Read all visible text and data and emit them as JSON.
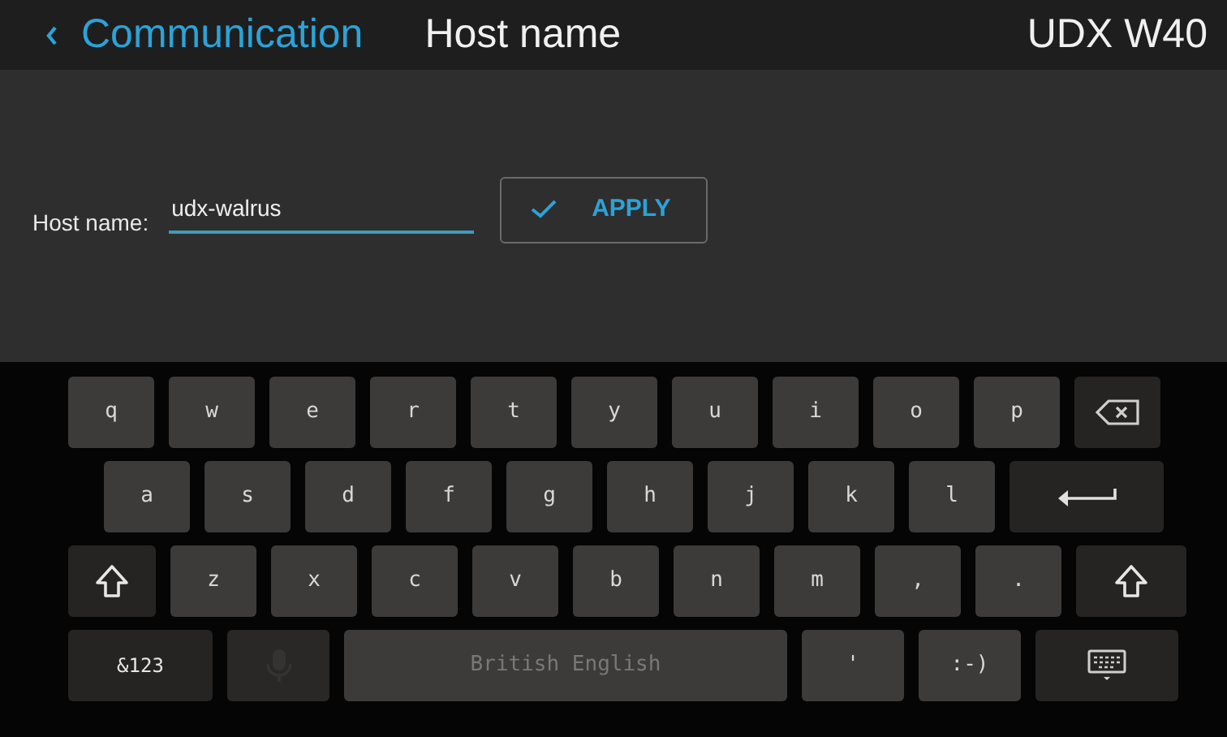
{
  "header": {
    "back_label": "Communication",
    "title": "Host name",
    "device": "UDX W40"
  },
  "form": {
    "label": "Host name:",
    "value": "udx-walrus",
    "apply": "APPLY"
  },
  "keyboard": {
    "rows": [
      {
        "keys": [
          {
            "kind": "letter",
            "label": "q"
          },
          {
            "kind": "letter",
            "label": "w"
          },
          {
            "kind": "letter",
            "label": "e"
          },
          {
            "kind": "letter",
            "label": "r"
          },
          {
            "kind": "letter",
            "label": "t"
          },
          {
            "kind": "letter",
            "label": "y"
          },
          {
            "kind": "letter",
            "label": "u"
          },
          {
            "kind": "letter",
            "label": "i"
          },
          {
            "kind": "letter",
            "label": "o"
          },
          {
            "kind": "letter",
            "label": "p"
          },
          {
            "kind": "backspace"
          }
        ]
      },
      {
        "keys": [
          {
            "kind": "letter",
            "label": "a"
          },
          {
            "kind": "letter",
            "label": "s"
          },
          {
            "kind": "letter",
            "label": "d"
          },
          {
            "kind": "letter",
            "label": "f"
          },
          {
            "kind": "letter",
            "label": "g"
          },
          {
            "kind": "letter",
            "label": "h"
          },
          {
            "kind": "letter",
            "label": "j"
          },
          {
            "kind": "letter",
            "label": "k"
          },
          {
            "kind": "letter",
            "label": "l"
          },
          {
            "kind": "enter"
          }
        ]
      },
      {
        "keys": [
          {
            "kind": "shift"
          },
          {
            "kind": "letter",
            "label": "z"
          },
          {
            "kind": "letter",
            "label": "x"
          },
          {
            "kind": "letter",
            "label": "c"
          },
          {
            "kind": "letter",
            "label": "v"
          },
          {
            "kind": "letter",
            "label": "b"
          },
          {
            "kind": "letter",
            "label": "n"
          },
          {
            "kind": "letter",
            "label": "m"
          },
          {
            "kind": "letter",
            "label": ","
          },
          {
            "kind": "letter",
            "label": "."
          },
          {
            "kind": "shift"
          }
        ]
      },
      {
        "keys": [
          {
            "kind": "symbols",
            "label": "&123"
          },
          {
            "kind": "mic"
          },
          {
            "kind": "space",
            "label": "British English"
          },
          {
            "kind": "wide",
            "label": "'"
          },
          {
            "kind": "wide",
            "label": ":-)"
          },
          {
            "kind": "hide"
          }
        ]
      }
    ]
  }
}
